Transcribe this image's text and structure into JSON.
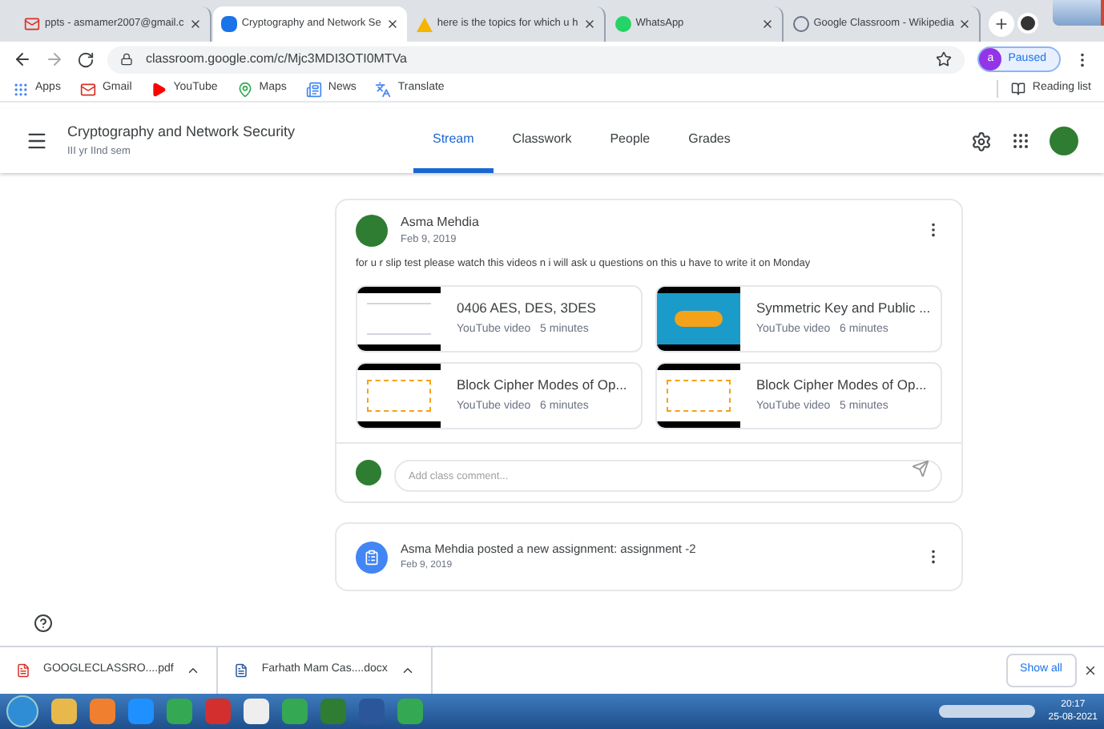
{
  "browser": {
    "tabs": [
      {
        "title": "ppts - asmamer2007@gmail.c",
        "selected": false
      },
      {
        "title": "Cryptography and Network Se",
        "selected": true
      },
      {
        "title": "here is the topics for which u h",
        "selected": false
      },
      {
        "title": "WhatsApp",
        "selected": false
      },
      {
        "title": "Google Classroom - Wikipedia",
        "selected": false
      }
    ],
    "url": "classroom.google.com/c/Mjc3MDI3OTI0MTVa",
    "profile": {
      "initial": "a",
      "status": "Paused"
    },
    "bookmarks": [
      {
        "label": "Apps"
      },
      {
        "label": "Gmail"
      },
      {
        "label": "YouTube"
      },
      {
        "label": "Maps"
      },
      {
        "label": "News"
      },
      {
        "label": "Translate"
      }
    ],
    "reading_list": "Reading list"
  },
  "classroom": {
    "title": "Cryptography and Network Security",
    "subtitle": "III yr IInd sem",
    "tabs": [
      {
        "label": "Stream",
        "selected": true
      },
      {
        "label": "Classwork",
        "selected": false
      },
      {
        "label": "People",
        "selected": false
      },
      {
        "label": "Grades",
        "selected": false
      }
    ]
  },
  "post": {
    "author": "Asma Mehdia",
    "date": "Feb 9, 2019",
    "text": "for u r slip test please watch this videos n i will ask u questions on this u have to write it on Monday",
    "attachments": [
      {
        "title": "0406 AES, DES, 3DES",
        "source": "YouTube video",
        "duration": "5 minutes"
      },
      {
        "title": "Symmetric Key and Public ...",
        "source": "YouTube video",
        "duration": "6 minutes"
      },
      {
        "title": "Block Cipher Modes of Op...",
        "source": "YouTube video",
        "duration": "6 minutes"
      },
      {
        "title": "Block Cipher Modes of Op...",
        "source": "YouTube video",
        "duration": "5 minutes"
      }
    ],
    "comment_placeholder": "Add class comment..."
  },
  "assignment": {
    "text": "Asma Mehdia posted a new assignment: assignment -2",
    "date": "Feb 9, 2019"
  },
  "downloads": {
    "items": [
      {
        "name": "GOOGLECLASSRO....pdf",
        "kind": "pdf"
      },
      {
        "name": "Farhath Mam Cas....docx",
        "kind": "docx"
      }
    ],
    "show_all": "Show all"
  },
  "taskbar": {
    "time": "20:17",
    "date": "25-08-2021"
  }
}
